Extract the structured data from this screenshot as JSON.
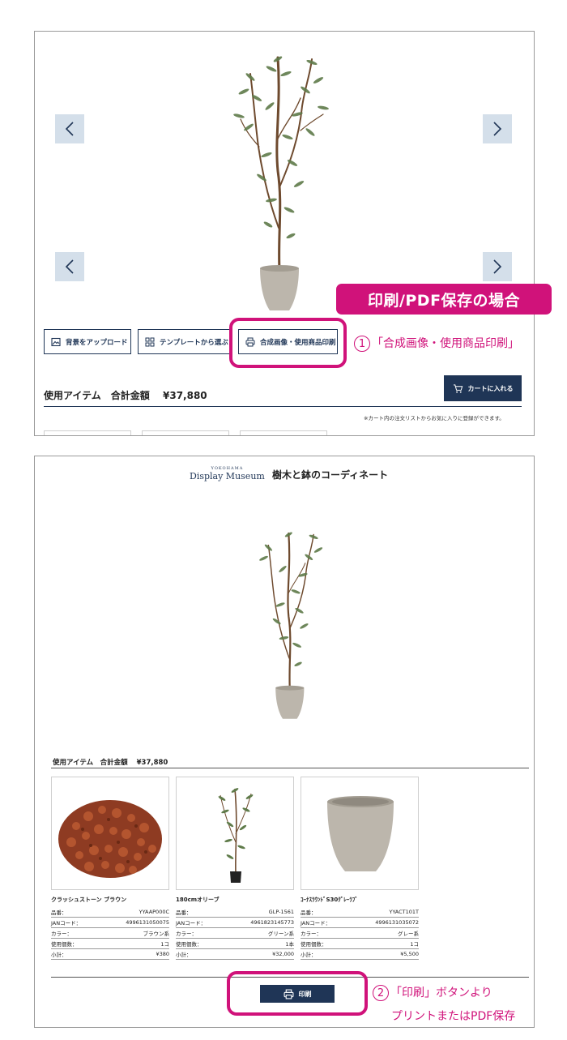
{
  "annotation": {
    "tag": "印刷/PDF保存の場合",
    "step1_num": "1",
    "step1_text": "「合成画像・使用商品印刷」",
    "step2_num": "2",
    "step2_line1": "「印刷」ボタンより",
    "step2_line2": "プリントまたはPDF保存",
    "color": "#d0127a"
  },
  "editor": {
    "buttons": {
      "upload_bg": "背景をアップロード",
      "template": "テンプレートから選ぶ",
      "print_combined": "合成画像・使用商品印刷"
    },
    "summary_label": "使用アイテム　合計金額",
    "total": "¥37,880",
    "cart_button": "カートに入れる",
    "cart_note": "※カート内の注文リストからお気に入りに登録ができます。"
  },
  "print_view": {
    "logo_small": "YOKOHAMA",
    "logo_main": "Display Museum",
    "title": "樹木と鉢のコーディネート",
    "summary_label": "使用アイテム　合計金額",
    "total": "¥37,880",
    "row_labels": {
      "code": "品番：",
      "jan": "JANコード：",
      "color": "カラー：",
      "qty": "使用個数：",
      "subtotal": "小計："
    },
    "products": [
      {
        "name": "クラッシュストーン ブラウン",
        "code": "YYAAP000C",
        "jan": "4996131050075",
        "color": "ブラウン系",
        "qty": "1コ",
        "subtotal": "¥380"
      },
      {
        "name": "180cmオリーブ",
        "code": "GLP-1561",
        "jan": "4961823145773",
        "color": "グリーン系",
        "qty": "1本",
        "subtotal": "¥32,000"
      },
      {
        "name": "ｺｰﾅｽﾗｳﾝﾄﾞS30ｸﾞﾚｰﾗﾌﾞ",
        "code": "YYACT101T",
        "jan": "4996131035072",
        "color": "グレー系",
        "qty": "1コ",
        "subtotal": "¥5,500"
      }
    ],
    "print_button": "印刷"
  },
  "colors": {
    "navy": "#1f3556",
    "nav_bg": "#d4dfea",
    "accent": "#d0127a"
  },
  "icons": [
    "chevron-left-icon",
    "chevron-right-icon",
    "image-icon",
    "grid-icon",
    "printer-icon",
    "cart-icon"
  ]
}
